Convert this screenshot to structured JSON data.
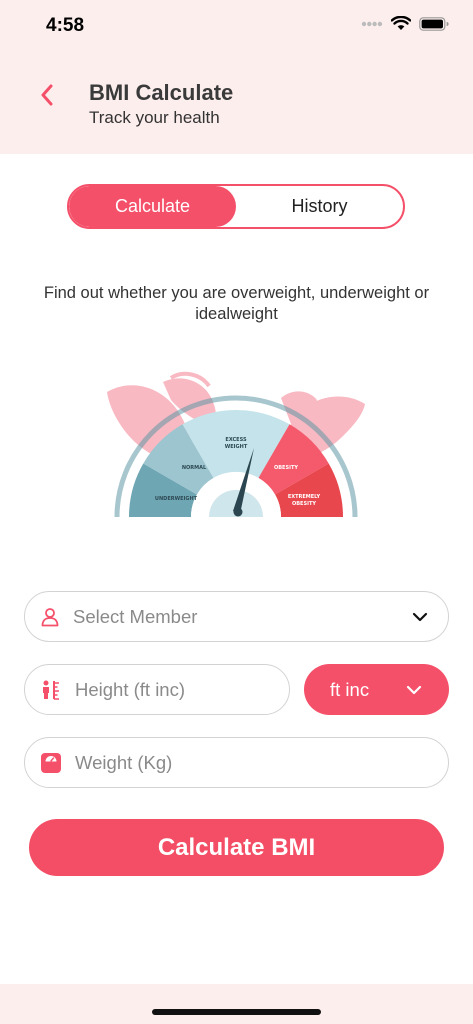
{
  "status_bar": {
    "time": "4:58"
  },
  "header": {
    "title": "BMI Calculate",
    "subtitle": "Track your health"
  },
  "tabs": [
    {
      "label": "Calculate",
      "active": true
    },
    {
      "label": "History",
      "active": false
    }
  ],
  "description": "Find out whether you are overweight, underweight or idealweight",
  "gauge": {
    "labels": {
      "underweight": "UNDERWEIGHT",
      "normal": "NORMAL",
      "excess_line1": "EXCESS",
      "excess_line2": "WEIGHT",
      "obesity": "OBESITY",
      "extreme_line1": "EXTREMELY",
      "extreme_line2": "OBESITY"
    }
  },
  "form": {
    "member_placeholder": "Select Member",
    "height_placeholder": "Height (ft inc)",
    "unit_selected": "ft inc",
    "weight_placeholder": "Weight (Kg)"
  },
  "cta_label": "Calculate BMI",
  "colors": {
    "accent": "#f5506a",
    "header_bg": "#fdeeee",
    "teal": "#6fa6b4",
    "leaf": "#f8b9c2"
  },
  "icons": {
    "back": "chevron-left-icon",
    "member": "person-icon",
    "height": "height-icon",
    "weight": "scale-icon",
    "dropdown": "chevron-down-icon"
  }
}
